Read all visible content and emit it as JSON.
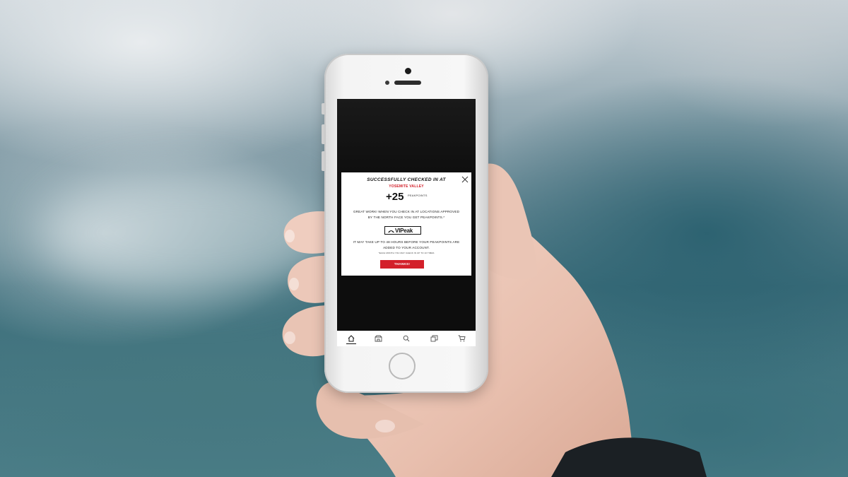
{
  "modal": {
    "headline": "SUCCESSFULLY CHECKED IN AT",
    "location": "YOSEMITE VALLEY",
    "points_value": "+25",
    "points_unit": "PEAKPOINTS",
    "message": "GREAT WORK! WHEN YOU CHECK IN AT LOCATIONS APPROVED BY THE NORTH FACE YOU GET PEAKPOINTS.*",
    "badge_text": "VIPeak",
    "delay_note": "IT MAY TAKE UP TO 48 HOURS BEFORE YOUR PEAKPOINTS ARE ADDED TO YOUR ACCOUNT.",
    "fine_print": "*EACH MONTH YOU MAY CHECK IN UP TO 10 TIMES",
    "button_label": "THANKS!"
  },
  "tabbar": {
    "items": [
      {
        "icon": "home-icon",
        "active": true
      },
      {
        "icon": "store-icon",
        "active": false
      },
      {
        "icon": "search-icon",
        "active": false
      },
      {
        "icon": "gallery-icon",
        "active": false
      },
      {
        "icon": "cart-icon",
        "active": false
      }
    ]
  },
  "colors": {
    "accent_red": "#d3202a",
    "modal_bg": "#ffffff",
    "screen_bg": "#0d0d0d"
  }
}
